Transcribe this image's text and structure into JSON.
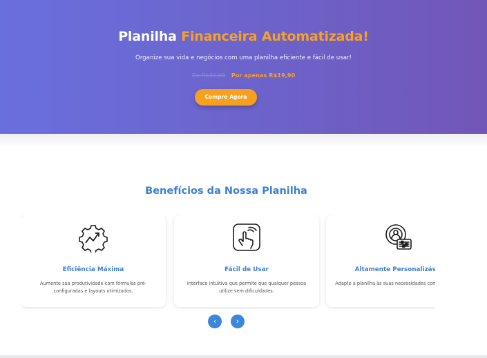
{
  "hero": {
    "title_part1": "Planilha ",
    "title_part2": "Financeira Automatizada!",
    "subtitle": "Organize sua vida e negócios com uma planilha eficiente e fácil de usar!",
    "old_price": "De R$30,00",
    "new_price": "Por apenas R$19,90",
    "cta_label": "Compre Agora"
  },
  "benefits": {
    "title": "Benefícios da Nossa Planilha",
    "cards": [
      {
        "icon": "gear-growth-icon",
        "title": "Eficiência Máxima",
        "description": "Aumente sua produtividade com fórmulas pré-configuradas e layouts otimizados."
      },
      {
        "icon": "touch-hand-icon",
        "title": "Fácil de Usar",
        "description": "Interface intuitiva que permite que qualquer pessoa utilize sem dificuldades."
      },
      {
        "icon": "user-settings-icon",
        "title": "Altamente Personalizável",
        "description": "Adapte a planilha às suas necessidades com facilidade."
      }
    ],
    "prev_label": "‹",
    "next_label": "›"
  },
  "colors": {
    "accent_orange": "#f5a021",
    "brand_blue": "#3d7fd4",
    "hero_start": "#6a6fde",
    "hero_end": "#7256b8"
  }
}
